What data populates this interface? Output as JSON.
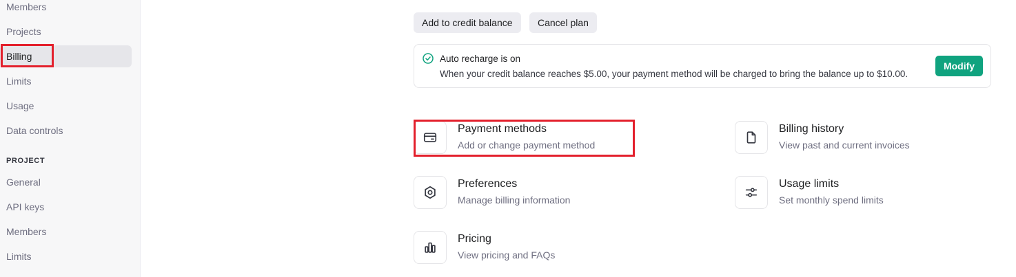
{
  "sidebar": {
    "org_items": [
      {
        "label": "Members"
      },
      {
        "label": "Projects"
      },
      {
        "label": "Billing"
      },
      {
        "label": "Limits"
      },
      {
        "label": "Usage"
      },
      {
        "label": "Data controls"
      }
    ],
    "project_section_label": "PROJECT",
    "project_items": [
      {
        "label": "General"
      },
      {
        "label": "API keys"
      },
      {
        "label": "Members"
      },
      {
        "label": "Limits"
      }
    ]
  },
  "actions": {
    "add_credit_label": "Add to credit balance",
    "cancel_plan_label": "Cancel plan"
  },
  "auto_recharge": {
    "title": "Auto recharge is on",
    "description": "When your credit balance reaches $5.00, your payment method will be charged to bring the balance up to $10.00.",
    "modify_label": "Modify"
  },
  "cards": {
    "payment_methods": {
      "title": "Payment methods",
      "description": "Add or change payment method"
    },
    "billing_history": {
      "title": "Billing history",
      "description": "View past and current invoices"
    },
    "preferences": {
      "title": "Preferences",
      "description": "Manage billing information"
    },
    "usage_limits": {
      "title": "Usage limits",
      "description": "Set monthly spend limits"
    },
    "pricing": {
      "title": "Pricing",
      "description": "View pricing and FAQs"
    }
  },
  "colors": {
    "accent": "#10a37f",
    "annotation": "#e3202c"
  }
}
